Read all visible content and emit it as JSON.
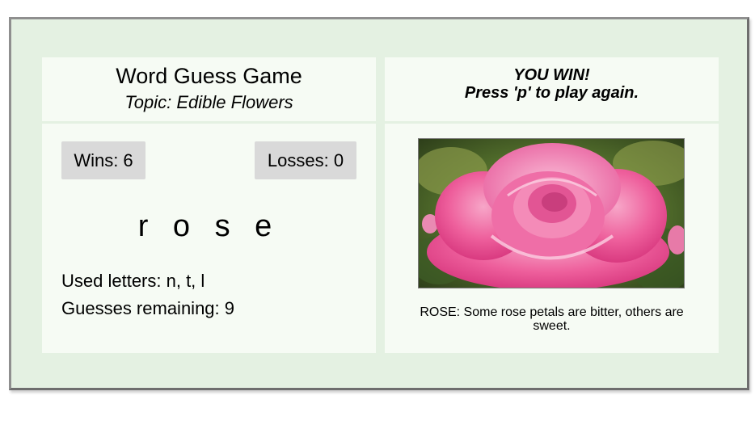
{
  "game": {
    "title": "Word Guess Game",
    "topic": "Topic: Edible Flowers"
  },
  "scores": {
    "wins_label": "Wins: 6",
    "losses_label": "Losses: 0"
  },
  "board": {
    "word": "r o s e",
    "used_letters": "Used letters: n, t, l",
    "guesses_remaining": "Guesses remaining: 9"
  },
  "status": {
    "line1": "YOU WIN!",
    "line2": "Press 'p' to play again."
  },
  "reveal": {
    "image_subject": "pink-rose-photo",
    "caption": "ROSE: Some rose petals are bitter, others are sweet."
  },
  "colors": {
    "frame_bg": "#e4f1e2",
    "panel_bg": "#f6fbf4",
    "score_bg": "#d9d9d9"
  }
}
